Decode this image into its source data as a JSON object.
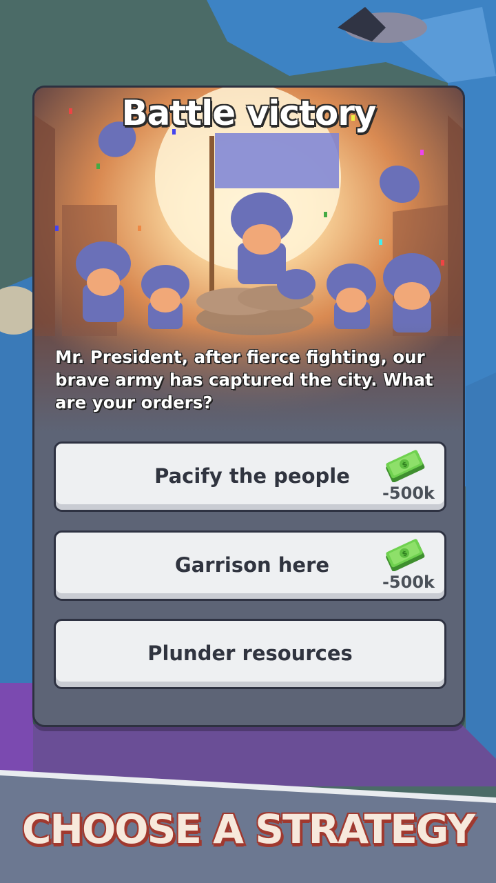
{
  "dialog": {
    "title": "Battle victory",
    "message": "Mr. President, after fierce fighting, our brave army has captured the city. What are your orders?"
  },
  "options": [
    {
      "label": "Pacify the people",
      "cost": "-500k",
      "cost_icon": "cash-icon"
    },
    {
      "label": "Garrison here",
      "cost": "-500k",
      "cost_icon": "cash-icon"
    },
    {
      "label": "Plunder resources"
    }
  ],
  "banner": {
    "text": "CHOOSE A STRATEGY"
  },
  "colors": {
    "card_bg": "#5d6476",
    "button_bg": "#eef0f2",
    "banner_text": "#f7e9dc",
    "banner_outline": "#a0392f",
    "cash_green": "#6fd14f"
  }
}
